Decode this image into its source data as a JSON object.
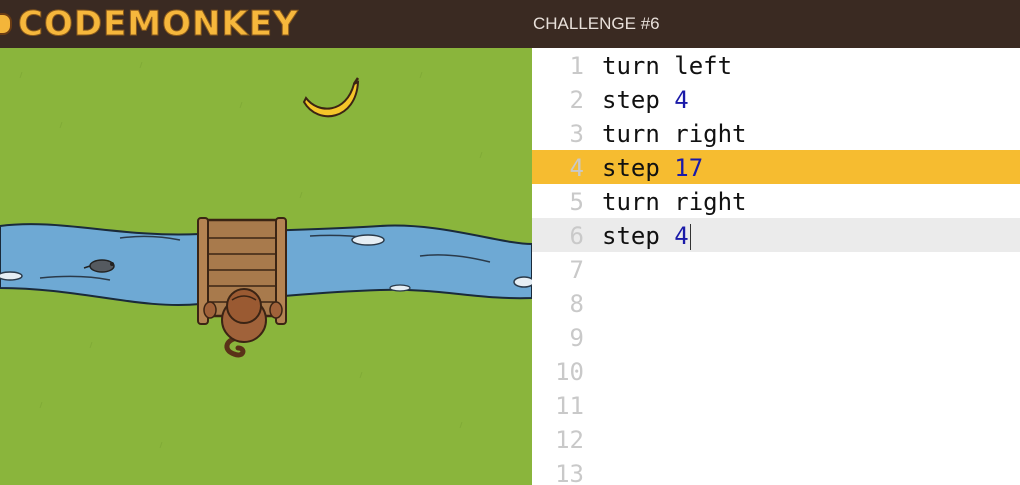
{
  "header": {
    "logo_text": "CODEMONKEY",
    "challenge_title": "CHALLENGE #6"
  },
  "game": {
    "sprites": [
      "banana-icon",
      "monkey-icon",
      "bridge-icon",
      "river",
      "rat-icon",
      "rock-icon"
    ]
  },
  "editor": {
    "lines": [
      {
        "num": "1",
        "cmd": "turn left",
        "arg": ""
      },
      {
        "num": "2",
        "cmd": "step ",
        "arg": "4"
      },
      {
        "num": "3",
        "cmd": "turn right",
        "arg": ""
      },
      {
        "num": "4",
        "cmd": "step ",
        "arg": "17"
      },
      {
        "num": "5",
        "cmd": "turn right",
        "arg": ""
      },
      {
        "num": "6",
        "cmd": "step ",
        "arg": "4"
      },
      {
        "num": "7",
        "cmd": "",
        "arg": ""
      },
      {
        "num": "8",
        "cmd": "",
        "arg": ""
      },
      {
        "num": "9",
        "cmd": "",
        "arg": ""
      },
      {
        "num": "10",
        "cmd": "",
        "arg": ""
      },
      {
        "num": "11",
        "cmd": "",
        "arg": ""
      },
      {
        "num": "12",
        "cmd": "",
        "arg": ""
      },
      {
        "num": "13",
        "cmd": "",
        "arg": ""
      }
    ],
    "active_line": "4",
    "cursor_line": "6"
  },
  "colors": {
    "topbar": "#3a2a22",
    "logo": "#f6b73c",
    "grass": "#8ab53c",
    "river": "#6ea9d4",
    "active_highlight": "#f6bc30",
    "cursor_highlight": "#ebebeb",
    "number_token": "#1a1aa8"
  }
}
